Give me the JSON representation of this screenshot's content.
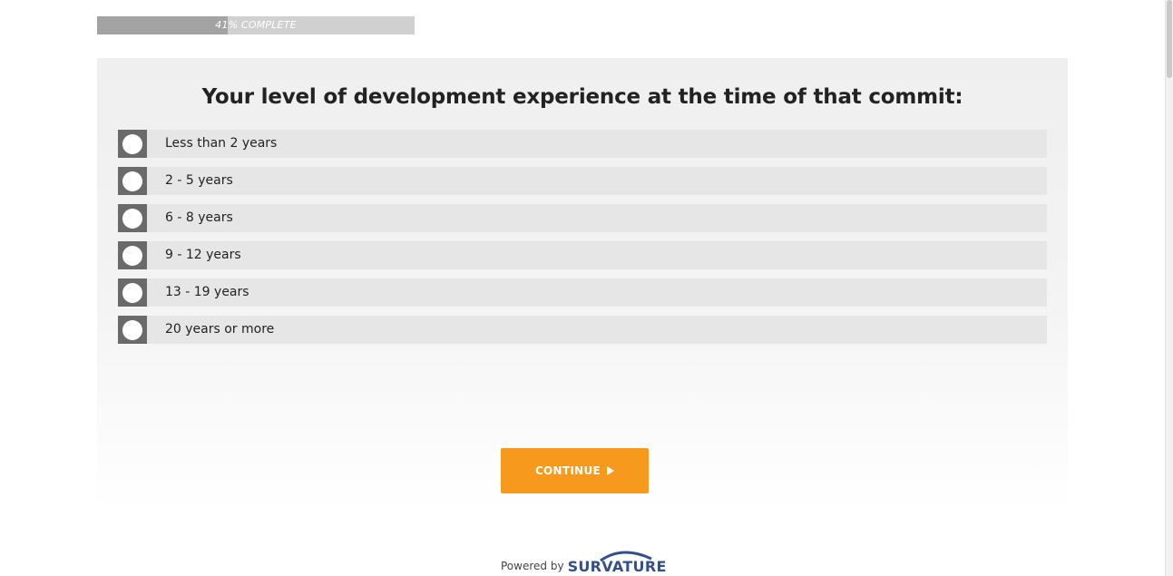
{
  "progress": {
    "percent": 41,
    "label": "41% COMPLETE"
  },
  "question": {
    "text": "Your level of development experience at the time of that commit:"
  },
  "options": [
    {
      "label": "Less than 2 years"
    },
    {
      "label": "2 - 5 years"
    },
    {
      "label": "6 - 8 years"
    },
    {
      "label": "9 - 12 years"
    },
    {
      "label": "13 - 19 years"
    },
    {
      "label": "20 years or more"
    }
  ],
  "continue_button": {
    "label": "CONTINUE",
    "icon": "play-arrow-icon"
  },
  "footer": {
    "powered_by": "Powered by",
    "brand": "SURVATURE"
  },
  "colors": {
    "accent": "#f7991c",
    "radio_box": "#6a6a6a",
    "option_bg": "#e6e6e6",
    "progress_fill": "#a3a3a3",
    "progress_track": "#d0d0d0",
    "brand": "#34508a"
  }
}
